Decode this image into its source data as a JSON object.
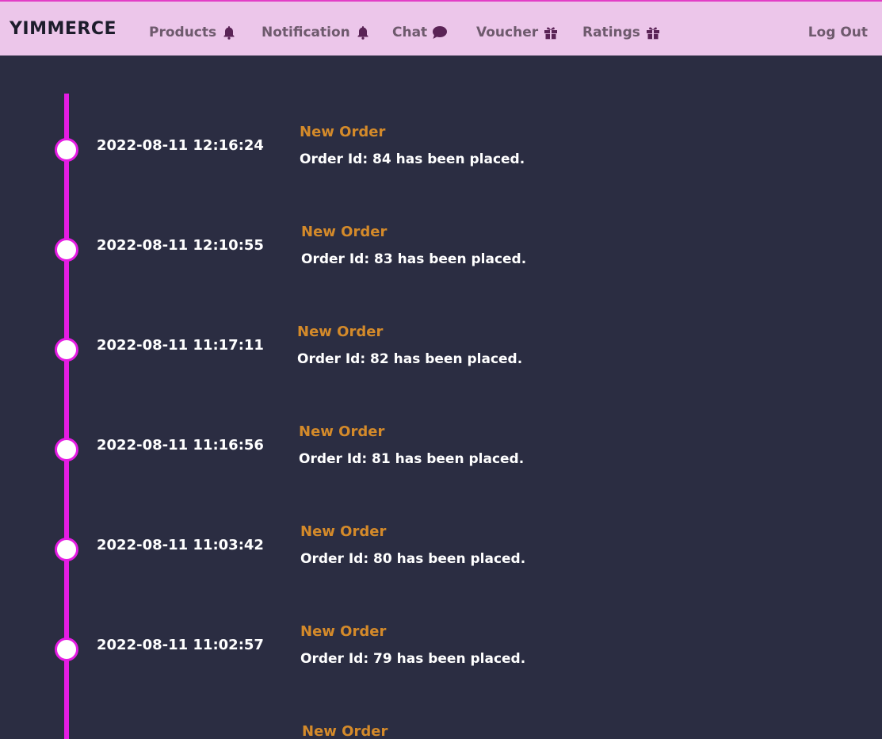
{
  "brand": "YIMMERCE",
  "nav": [
    {
      "label": "Products",
      "icon": "bell-icon"
    },
    {
      "label": "Notification",
      "icon": "bell-icon"
    },
    {
      "label": "Chat",
      "icon": "chat-bubble-icon"
    },
    {
      "label": "Voucher",
      "icon": "gift-icon"
    },
    {
      "label": "Ratings",
      "icon": "gift-icon"
    }
  ],
  "logout": "Log Out",
  "colors": {
    "navbar_bg": "#ecc6ea",
    "page_bg": "#2b2d42",
    "timeline": "#e51ce3",
    "event_title": "#d48a2a",
    "icon": "#5a2356"
  },
  "events": [
    {
      "date": "2022-08-11 12:16:24",
      "title": "New Order",
      "desc": "Order Id: 84 has been placed."
    },
    {
      "date": "2022-08-11 12:10:55",
      "title": "New Order",
      "desc": "Order Id: 83 has been placed."
    },
    {
      "date": "2022-08-11 11:17:11",
      "title": "New Order",
      "desc": "Order Id: 82 has been placed."
    },
    {
      "date": "2022-08-11 11:16:56",
      "title": "New Order",
      "desc": "Order Id: 81 has been placed."
    },
    {
      "date": "2022-08-11 11:03:42",
      "title": "New Order",
      "desc": "Order Id: 80 has been placed."
    },
    {
      "date": "2022-08-11 11:02:57",
      "title": "New Order",
      "desc": "Order Id: 79 has been placed."
    },
    {
      "date": "",
      "title": "New Order",
      "desc": ""
    }
  ]
}
